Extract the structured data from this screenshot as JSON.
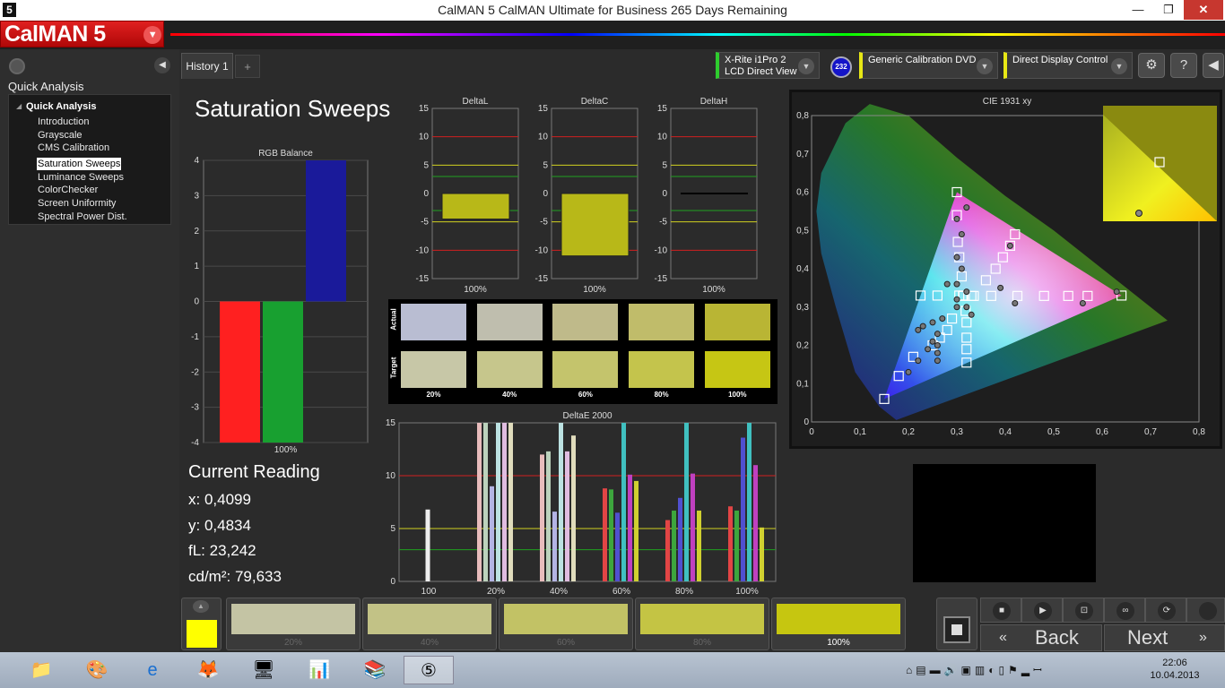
{
  "window": {
    "title": "CalMAN 5 CalMAN Ultimate for Business 265 Days Remaining",
    "app_icon": "5",
    "controls": {
      "min": "—",
      "max": "❐",
      "close": "✕"
    }
  },
  "header": {
    "logo": "CalMAN 5"
  },
  "sidebar": {
    "heading": "Quick Analysis",
    "root": "Quick Analysis",
    "items": [
      {
        "label": "Introduction"
      },
      {
        "label": "Grayscale"
      },
      {
        "label": "CMS Calibration"
      },
      {
        "label": "Saturation Sweeps",
        "selected": true
      },
      {
        "label": "Luminance Sweeps"
      },
      {
        "label": "ColorChecker"
      },
      {
        "label": "Screen Uniformity"
      },
      {
        "label": "Spectral Power Dist."
      }
    ]
  },
  "tabs": {
    "active": "History 1",
    "add": "+"
  },
  "devices": {
    "meter": {
      "line1": "X-Rite i1Pro 2",
      "line2": "LCD Direct View"
    },
    "meter_badge": "232",
    "source": "Generic Calibration DVD",
    "display": "Direct Display Control"
  },
  "page": {
    "title": "Saturation Sweeps"
  },
  "reading": {
    "heading": "Current Reading",
    "x": "x: 0,4099",
    "y": "y: 0,4834",
    "fl": "fL: 23,242",
    "cdm2": "cd/m²: 79,633"
  },
  "swatch_strip": {
    "row_actual": "Actual",
    "row_target": "Target",
    "labels": [
      "20%",
      "40%",
      "60%",
      "80%",
      "100%"
    ],
    "actual_colors": [
      "#b9bdd2",
      "#bfbeae",
      "#bfba8a",
      "#c0bc6a",
      "#b9b534"
    ],
    "target_colors": [
      "#c7c7a7",
      "#c6c68c",
      "#c4c46c",
      "#c4c44c",
      "#c6c614"
    ]
  },
  "bottom": {
    "current_color": "#ffff00",
    "steps": [
      {
        "label": "20%",
        "color": "#c4c4a4"
      },
      {
        "label": "40%",
        "color": "#c2c286"
      },
      {
        "label": "60%",
        "color": "#c2c265"
      },
      {
        "label": "80%",
        "color": "#c4c444"
      },
      {
        "label": "100%",
        "color": "#c6c610",
        "current": true
      }
    ]
  },
  "nav": {
    "back": "Back",
    "next": "Next"
  },
  "taskbar": {
    "time": "22:06",
    "date": "10.04.2013"
  },
  "chart_data": [
    {
      "type": "bar",
      "title": "RGB Balance",
      "categories": [
        "100%"
      ],
      "ylim": [
        -4,
        4
      ],
      "series": [
        {
          "name": "R",
          "values": [
            -4.0
          ],
          "color": "#ff2020"
        },
        {
          "name": "G",
          "values": [
            -4.0
          ],
          "color": "#18a030"
        },
        {
          "name": "B",
          "values": [
            4.0
          ],
          "color": "#1a1a9a"
        }
      ]
    },
    {
      "type": "bar",
      "title": "DeltaL",
      "categories": [
        "100%"
      ],
      "ylim": [
        -15,
        15
      ],
      "values": [
        -4.5
      ]
    },
    {
      "type": "bar",
      "title": "DeltaC",
      "categories": [
        "100%"
      ],
      "ylim": [
        -15,
        15
      ],
      "values": [
        -11
      ]
    },
    {
      "type": "bar",
      "title": "DeltaH",
      "categories": [
        "100%"
      ],
      "ylim": [
        -15,
        15
      ],
      "values": [
        0
      ]
    },
    {
      "type": "bar",
      "title": "DeltaE 2000",
      "categories": [
        "100",
        "20%",
        "40%",
        "60%",
        "80%",
        "100%"
      ],
      "ylim": [
        0,
        15
      ],
      "groups": [
        [
          6.8
        ],
        [
          15,
          15,
          9,
          15,
          15,
          15
        ],
        [
          12,
          12.3,
          6.6,
          15,
          12.3,
          13.8
        ],
        [
          8.8,
          8.7,
          6.5,
          15,
          10.1,
          9.5
        ],
        [
          5.8,
          6.7,
          7.9,
          15,
          10.2,
          6.7
        ],
        [
          7.1,
          6.7,
          13.6,
          15,
          11,
          5.1
        ]
      ]
    },
    {
      "type": "scatter",
      "title": "CIE 1931 xy",
      "xlim": [
        0,
        0.8
      ],
      "ylim": [
        0,
        0.8
      ],
      "gamut": [
        [
          0.64,
          0.33
        ],
        [
          0.3,
          0.6
        ],
        [
          0.15,
          0.06
        ]
      ],
      "targets": [
        [
          0.3127,
          0.329
        ],
        [
          0.335,
          0.329
        ],
        [
          0.371,
          0.329
        ],
        [
          0.425,
          0.329
        ],
        [
          0.48,
          0.329
        ],
        [
          0.53,
          0.329
        ],
        [
          0.57,
          0.329
        ],
        [
          0.64,
          0.33
        ],
        [
          0.31,
          0.38
        ],
        [
          0.305,
          0.43
        ],
        [
          0.302,
          0.47
        ],
        [
          0.3,
          0.54
        ],
        [
          0.3,
          0.6
        ],
        [
          0.33,
          0.329
        ],
        [
          0.305,
          0.33
        ],
        [
          0.26,
          0.33
        ],
        [
          0.225,
          0.33
        ],
        [
          0.29,
          0.27
        ],
        [
          0.28,
          0.24
        ],
        [
          0.265,
          0.22
        ],
        [
          0.25,
          0.2
        ],
        [
          0.21,
          0.17
        ],
        [
          0.18,
          0.12
        ],
        [
          0.15,
          0.06
        ],
        [
          0.3135,
          0.33
        ],
        [
          0.318,
          0.29
        ],
        [
          0.32,
          0.26
        ],
        [
          0.32,
          0.22
        ],
        [
          0.32,
          0.19
        ],
        [
          0.32,
          0.155
        ],
        [
          0.36,
          0.37
        ],
        [
          0.38,
          0.4
        ],
        [
          0.395,
          0.43
        ],
        [
          0.41,
          0.46
        ],
        [
          0.42,
          0.49
        ]
      ],
      "measured": [
        [
          0.32,
          0.3
        ],
        [
          0.42,
          0.31
        ],
        [
          0.56,
          0.31
        ],
        [
          0.63,
          0.34
        ],
        [
          0.32,
          0.34
        ],
        [
          0.3,
          0.36
        ],
        [
          0.31,
          0.4
        ],
        [
          0.3,
          0.43
        ],
        [
          0.31,
          0.49
        ],
        [
          0.32,
          0.56
        ],
        [
          0.3,
          0.53
        ],
        [
          0.27,
          0.27
        ],
        [
          0.25,
          0.26
        ],
        [
          0.23,
          0.25
        ],
        [
          0.22,
          0.24
        ],
        [
          0.26,
          0.23
        ],
        [
          0.25,
          0.21
        ],
        [
          0.24,
          0.19
        ],
        [
          0.22,
          0.16
        ],
        [
          0.2,
          0.13
        ],
        [
          0.26,
          0.2
        ],
        [
          0.26,
          0.18
        ],
        [
          0.26,
          0.16
        ],
        [
          0.3,
          0.3
        ],
        [
          0.3,
          0.32
        ],
        [
          0.28,
          0.36
        ],
        [
          0.33,
          0.28
        ],
        [
          0.39,
          0.35
        ],
        [
          0.41,
          0.46
        ]
      ],
      "inset_measured": [
        0.4099,
        0.4834
      ]
    }
  ],
  "icons": [
    "app-logo-icon",
    "settings-gear-icon",
    "help-icon",
    "collapse-icon",
    "stop-icon",
    "play-icon",
    "fit-icon",
    "loop-icon",
    "sync-icon"
  ]
}
